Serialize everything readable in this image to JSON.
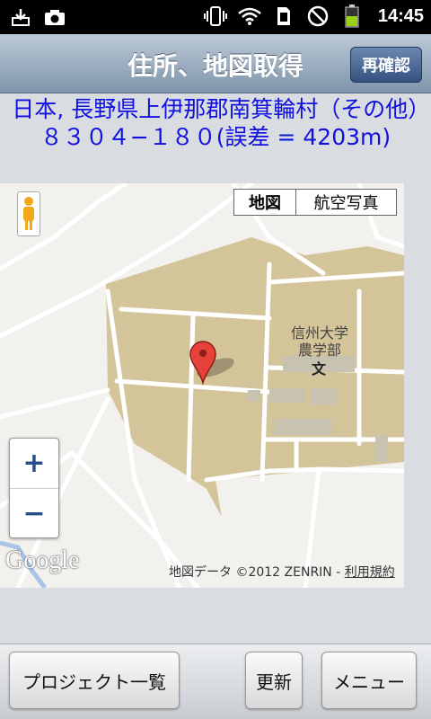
{
  "status_bar": {
    "time": "14:45",
    "icons": [
      "download-icon",
      "camera-icon",
      "vibrate-icon",
      "wifi-icon",
      "sd-card-icon",
      "no-signal-icon",
      "battery-icon"
    ]
  },
  "header": {
    "title": "住所、地図取得",
    "recheck_label": "再確認"
  },
  "address": {
    "text": "日本, 長野県上伊那郡南箕輪村（その他）８３０４−１８０(誤差 = 4203m)"
  },
  "map": {
    "type_map_label": "地図",
    "type_aerial_label": "航空写真",
    "zoom_in": "+",
    "zoom_out": "−",
    "logo_text": "Google",
    "credit_text": "地図データ ©2012 ZENRIN - ",
    "terms_label": "利用規約",
    "label_university": "信州大学",
    "label_faculty": "農学部",
    "label_school_symbol": "文"
  },
  "bottom": {
    "project_list_label": "プロジェクト一覧",
    "update_label": "更新",
    "menu_label": "メニュー"
  },
  "colors": {
    "address_text": "#1010e0",
    "campus_area": "#d4c49a",
    "titlebar_top": "#bcc9d6",
    "titlebar_bottom": "#7f95ab"
  }
}
